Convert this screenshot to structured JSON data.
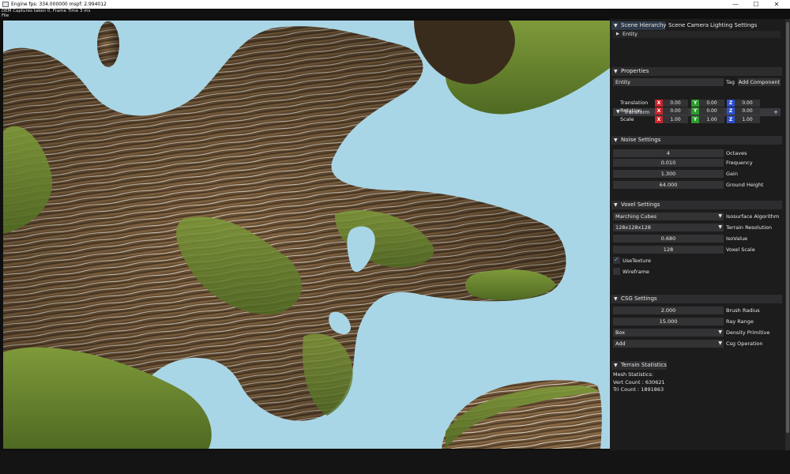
{
  "window": {
    "title": "Engine fps: 334.000000   mspf: 2.994012",
    "minimize_glyph": "—",
    "maximize_glyph": "☐",
    "close_glyph": "✕"
  },
  "status": {
    "line1": "DEM Captures taken 0, Frame Time 3 ms",
    "line2": "File"
  },
  "hierarchy_tabs": {
    "tabs": [
      {
        "label": "Scene Hierarchy",
        "active": true
      },
      {
        "label": "Scene Camera",
        "active": false
      },
      {
        "label": "Lighting Settings",
        "active": false
      }
    ],
    "entity": "Entity"
  },
  "properties": {
    "header": "Properties",
    "name_value": "Entity",
    "tag_label": "Tag",
    "add_component": "Add Component",
    "transform_header": "Transform",
    "transform_plus": "+",
    "rows": [
      {
        "label": "Translation",
        "x": "0.00",
        "y": "0.00",
        "z": "0.00"
      },
      {
        "label": "Rotation",
        "x": "0.00",
        "y": "0.00",
        "z": "0.00"
      },
      {
        "label": "Scale",
        "x": "1.00",
        "y": "1.00",
        "z": "1.00"
      }
    ],
    "axis_x": "X",
    "axis_y": "Y",
    "axis_z": "Z"
  },
  "noise": {
    "header": "Noise Settings",
    "fields": [
      {
        "value": "4",
        "label": "Octaves"
      },
      {
        "value": "0.010",
        "label": "Frequency"
      },
      {
        "value": "1.300",
        "label": "Gain"
      },
      {
        "value": "64.000",
        "label": "Ground Height"
      }
    ]
  },
  "voxel": {
    "header": "Voxel Settings",
    "algorithm_value": "Marching Cubes",
    "algorithm_label": "Isosurface Algorithm",
    "resolution_value": "128x128x128",
    "resolution_label": "Terrain Resolution",
    "isovalue_value": "0.680",
    "isovalue_label": "IsoValue",
    "scale_value": "128",
    "scale_label": "Voxel Scale",
    "use_texture_label": "UseTexture",
    "use_texture_checked": true,
    "wireframe_label": "Wireframe",
    "wireframe_checked": false
  },
  "csg": {
    "header": "CSG Settings",
    "brush_radius_value": "2.000",
    "brush_radius_label": "Brush Radius",
    "ray_range_value": "15.000",
    "ray_range_label": "Ray Range",
    "primitive_value": "Box",
    "primitive_label": "Density Primitive",
    "operation_value": "Add",
    "operation_label": "Csg Operation"
  },
  "terrain_stats": {
    "header": "Terrain Statistics",
    "title": "Mesh Statistics:",
    "vert": "Vert Count : 630621",
    "tri": "Tri  Count : 1891863"
  },
  "colors": {
    "sky": "#a9d6e6",
    "panel_bg": "#1c1c1c",
    "header_bg": "#2d2d2f",
    "axis_x": "#c8242a",
    "axis_y": "#2d9b2d",
    "axis_z": "#2b4fd0"
  },
  "icons": {
    "collapse": "▼",
    "expand": "▶",
    "combo": "▼",
    "check": "✓"
  }
}
